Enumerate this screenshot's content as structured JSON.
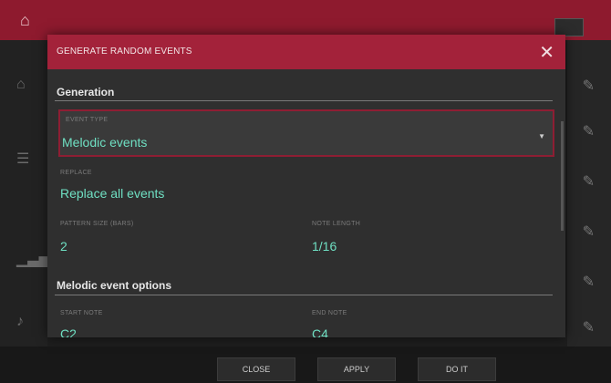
{
  "modal": {
    "title": "GENERATE RANDOM EVENTS",
    "generation": {
      "section_title": "Generation",
      "type_label": "Event Type",
      "type_value": "Melodic events",
      "replace_label": "Replace",
      "replace_value": "Replace all events",
      "pattern_size_label": "Pattern size (bars)",
      "pattern_size_value": "2",
      "note_length_label": "Note length",
      "note_length_value": "1/16"
    },
    "melodic": {
      "section_title": "Melodic event options",
      "start_note_label": "Start note",
      "start_note_value": "C2",
      "end_note_label": "End note",
      "end_note_value": "C4"
    }
  },
  "buttons": {
    "close": "CLOSE",
    "apply": "APPLY",
    "do_it": "DO IT"
  },
  "colors": {
    "accent": "#a3223a",
    "value": "#6fe0c3"
  }
}
